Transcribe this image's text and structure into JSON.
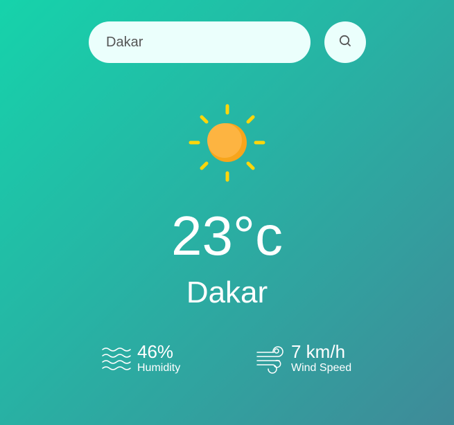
{
  "search": {
    "value": "Dakar",
    "button_icon": "search-icon"
  },
  "weather": {
    "icon": "sun-icon",
    "temperature": "23°c",
    "city": "Dakar"
  },
  "details": {
    "humidity": {
      "icon": "humidity-waves-icon",
      "value": "46%",
      "label": "Humidity"
    },
    "wind": {
      "icon": "wind-icon",
      "value": "7 km/h",
      "label": "Wind Speed"
    }
  },
  "colors": {
    "background_start": "#16d3ab",
    "background_end": "#3f8a98",
    "search_background": "#ebfffc",
    "sun_body": "#fdb441",
    "sun_rays": "#ffd60a",
    "text": "#ffffff"
  }
}
